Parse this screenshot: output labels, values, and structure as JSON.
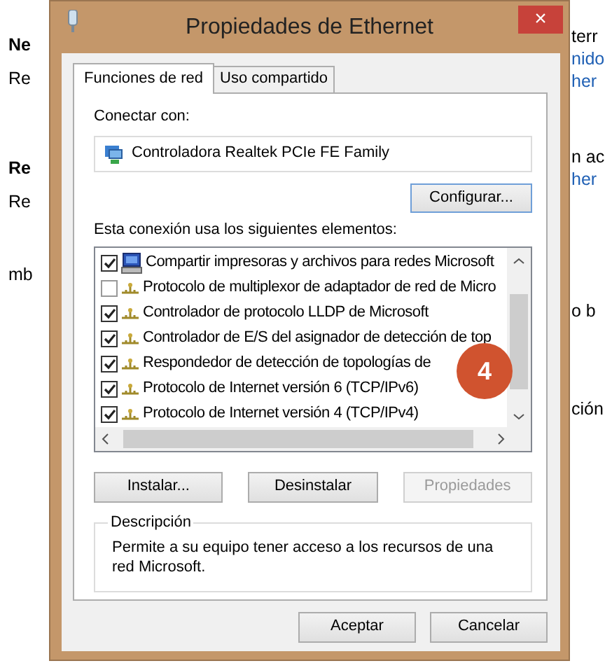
{
  "background": {
    "left": [
      {
        "text": "Ne",
        "bold": true
      },
      {
        "text": "Re",
        "bold": false
      },
      {
        "text": "Re",
        "bold": true
      },
      {
        "text": "Re",
        "bold": false
      },
      {
        "text": "mb",
        "bold": false
      }
    ],
    "right": [
      {
        "text": "terr",
        "link": false
      },
      {
        "text": "nido",
        "link": true
      },
      {
        "text": "her",
        "link": true
      },
      {
        "text": "n ac",
        "link": false
      },
      {
        "text": "her",
        "link": true
      },
      {
        "text": "o b",
        "link": false
      },
      {
        "text": "ción",
        "link": false
      }
    ]
  },
  "window": {
    "title": "Propiedades de Ethernet",
    "close": "×"
  },
  "tabs": [
    {
      "label": "Funciones de red",
      "selected": true
    },
    {
      "label": "Uso compartido",
      "selected": false
    }
  ],
  "connect_label": "Conectar con:",
  "adapter": "Controladora Realtek PCIe FE Family",
  "configure_button": "Configurar...",
  "elements_label": "Esta conexión usa los siguientes elementos:",
  "elements": [
    {
      "label": "Compartir impresoras y archivos para redes Microsoft",
      "checked": true,
      "kind": "service"
    },
    {
      "label": "Protocolo de multiplexor de adaptador de red de Micro",
      "checked": false,
      "kind": "protocol"
    },
    {
      "label": "Controlador de protocolo LLDP de Microsoft",
      "checked": true,
      "kind": "protocol"
    },
    {
      "label": "Controlador de E/S del asignador de detección de top",
      "checked": true,
      "kind": "protocol"
    },
    {
      "label": "Respondedor de detección de topologías de",
      "checked": true,
      "kind": "protocol"
    },
    {
      "label": "Protocolo de Internet versión 6 (TCP/IPv6)",
      "checked": true,
      "kind": "protocol"
    },
    {
      "label": "Protocolo de Internet versión 4 (TCP/IPv4)",
      "checked": true,
      "kind": "protocol"
    }
  ],
  "step_badge": "4",
  "actions": [
    {
      "label": "Instalar...",
      "disabled": false
    },
    {
      "label": "Desinstalar",
      "disabled": false
    },
    {
      "label": "Propiedades",
      "disabled": true
    }
  ],
  "description": {
    "title": "Descripción",
    "text": "Permite a su equipo tener acceso a los recursos de una red Microsoft."
  },
  "buttons": [
    "Aceptar",
    "Cancelar"
  ]
}
